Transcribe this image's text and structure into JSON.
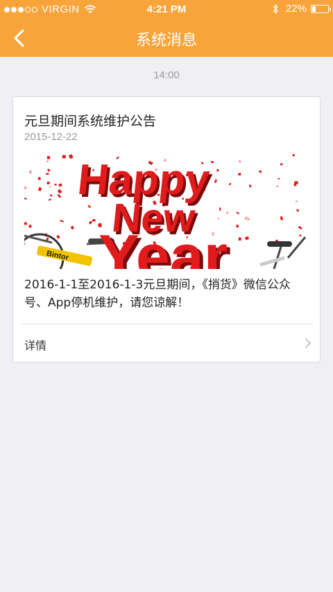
{
  "status_bar": {
    "carrier": "VIRGIN",
    "time": "4:21 PM",
    "battery_percent": "22%",
    "battery_level": 0.22,
    "signal_filled": 3,
    "signal_total": 5
  },
  "nav": {
    "title": "系统消息",
    "back_icon": "chevron-left-icon"
  },
  "feed": {
    "time_label": "14:00"
  },
  "message": {
    "title": "元旦期间系统维护公告",
    "date": "2015-12-22",
    "banner": {
      "line1": "Happy",
      "line2": "New",
      "line3": "Year",
      "bike_brand": "Bintor"
    },
    "body": "2016-1-1至2016-1-3元旦期间，《捎货》微信公众号、App停机维护，请您谅解！",
    "detail_label": "详情"
  },
  "colors": {
    "accent": "#f8a43b",
    "background": "#efeff4",
    "banner_red": "#e01b1b"
  }
}
